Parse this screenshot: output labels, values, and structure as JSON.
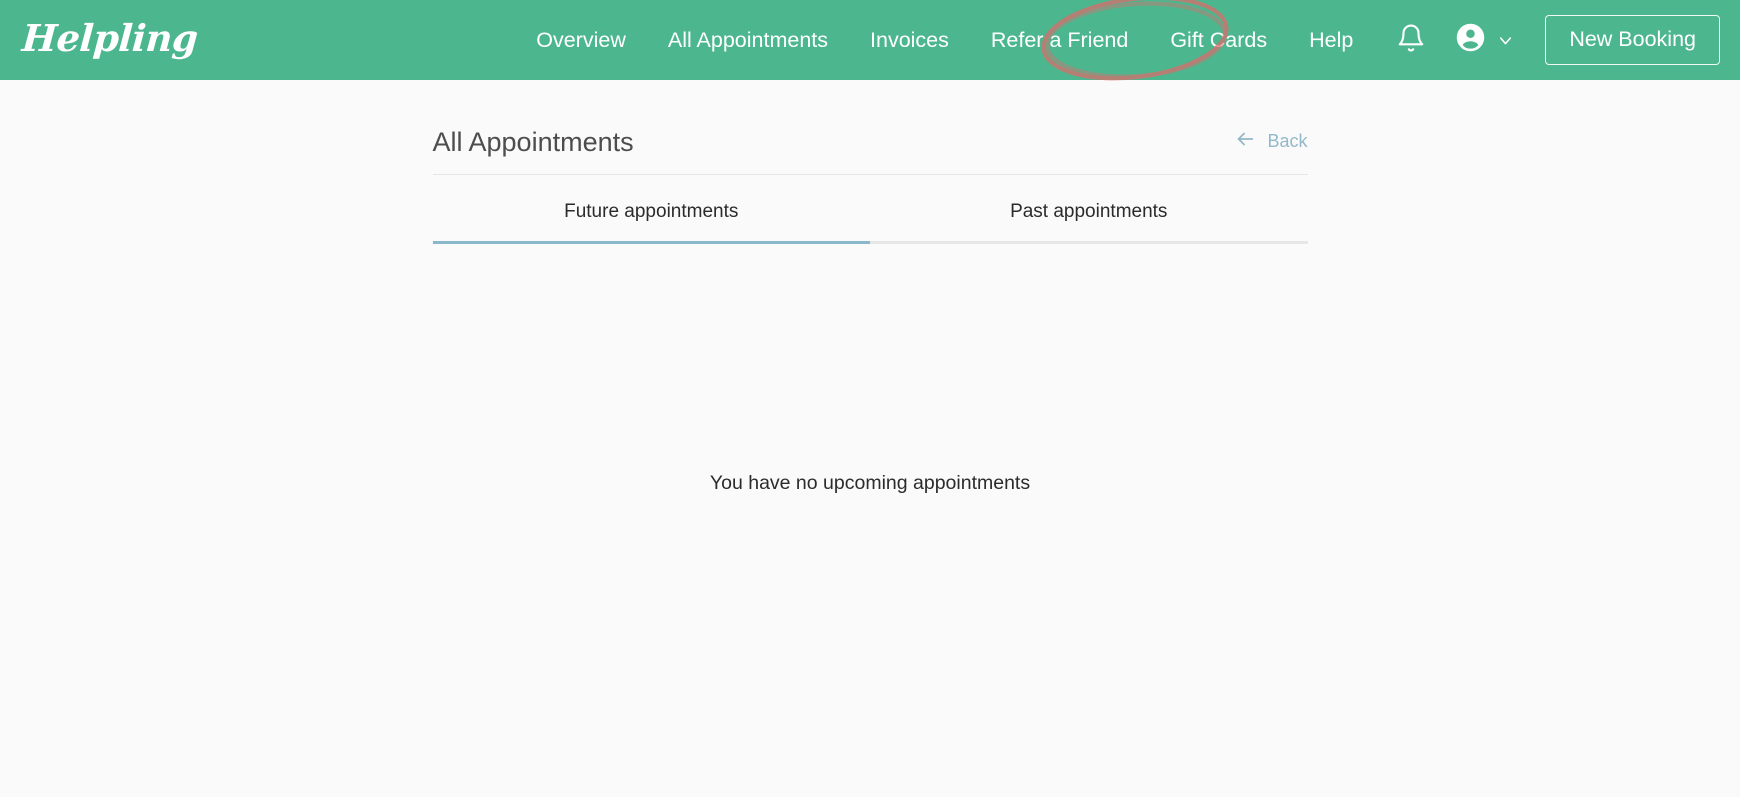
{
  "brand": {
    "logo_text": "Helpling",
    "header_color": "#4cb78f",
    "accent_tab_color": "#89b8cc",
    "link_color": "#92b8c9",
    "annotation_color": "#e06a6a"
  },
  "header": {
    "nav_items": [
      {
        "label": "Overview",
        "name": "nav-overview"
      },
      {
        "label": "All Appointments",
        "name": "nav-all-appointments"
      },
      {
        "label": "Invoices",
        "name": "nav-invoices"
      },
      {
        "label": "Refer a Friend",
        "name": "nav-refer-a-friend"
      },
      {
        "label": "Gift Cards",
        "name": "nav-gift-cards"
      },
      {
        "label": "Help",
        "name": "nav-help"
      }
    ],
    "notifications_icon": "bell-icon",
    "account_icon": "account-circle-icon",
    "account_chevron_icon": "chevron-down-icon",
    "new_booking_label": "New Booking",
    "annotation": "highlight-ellipse-refer-a-friend"
  },
  "main": {
    "page_title": "All Appointments",
    "back_label": "Back",
    "back_icon": "arrow-left-icon",
    "tabs": [
      {
        "label": "Future appointments",
        "active": true
      },
      {
        "label": "Past appointments",
        "active": false
      }
    ],
    "empty_state_message": "You have no upcoming appointments"
  }
}
